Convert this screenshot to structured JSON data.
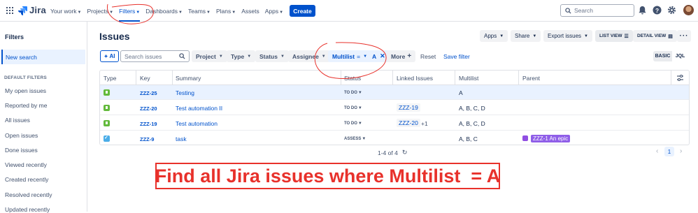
{
  "app": {
    "name": "Jira"
  },
  "topnav": {
    "items": [
      "Your work",
      "Projects",
      "Filters",
      "Dashboards",
      "Teams",
      "Plans",
      "Assets",
      "Apps"
    ],
    "active": "Filters",
    "create_label": "Create",
    "search_placeholder": "Search"
  },
  "sidebar": {
    "title": "Filters",
    "new_search": "New search",
    "section_label": "DEFAULT FILTERS",
    "items": [
      "My open issues",
      "Reported by me",
      "All issues",
      "Open issues",
      "Done issues",
      "Viewed recently",
      "Created recently",
      "Resolved recently",
      "Updated recently"
    ]
  },
  "header": {
    "title": "Issues",
    "apps_label": "Apps",
    "share_label": "Share",
    "export_label": "Export issues",
    "list_view_label": "LIST VIEW",
    "detail_view_label": "DETAIL VIEW"
  },
  "filters": {
    "ai_label": "AI",
    "search_placeholder": "Search issues",
    "project": "Project",
    "type": "Type",
    "status": "Status",
    "assignee": "Assignee",
    "multilist_label": "Multilist",
    "multilist_op": "=",
    "multilist_value": "A",
    "more": "More",
    "reset": "Reset",
    "save": "Save filter",
    "basic": "BASIC",
    "jql": "JQL"
  },
  "table": {
    "columns": [
      "Type",
      "Key",
      "Summary",
      "Status",
      "Linked Issues",
      "Multilist",
      "Parent"
    ],
    "rows": [
      {
        "type": "story",
        "key": "ZZZ-25",
        "summary": "Testing",
        "status": "TO DO",
        "linked": "",
        "linked_extra": "",
        "multilist": "A",
        "parent": ""
      },
      {
        "type": "story",
        "key": "ZZZ-20",
        "summary": "Test automation II",
        "status": "TO DO",
        "linked": "ZZZ-19",
        "linked_extra": "",
        "multilist": "A, B, C, D",
        "parent": ""
      },
      {
        "type": "story",
        "key": "ZZZ-19",
        "summary": "Test automation",
        "status": "TO DO",
        "linked": "ZZZ-20",
        "linked_extra": "+1",
        "multilist": "A, B, C, D",
        "parent": ""
      },
      {
        "type": "task",
        "key": "ZZZ-9",
        "summary": "task",
        "status": "ASSESS",
        "linked": "",
        "linked_extra": "",
        "multilist": "A, B, C",
        "parent": "ZZZ-1 An epic"
      }
    ],
    "count_label": "1-4 of 4",
    "page": "1"
  },
  "caption": "Find all Jira issues where Multilist  = A",
  "colors": {
    "brand": "#0052cc",
    "annotation": "#e8312b"
  }
}
